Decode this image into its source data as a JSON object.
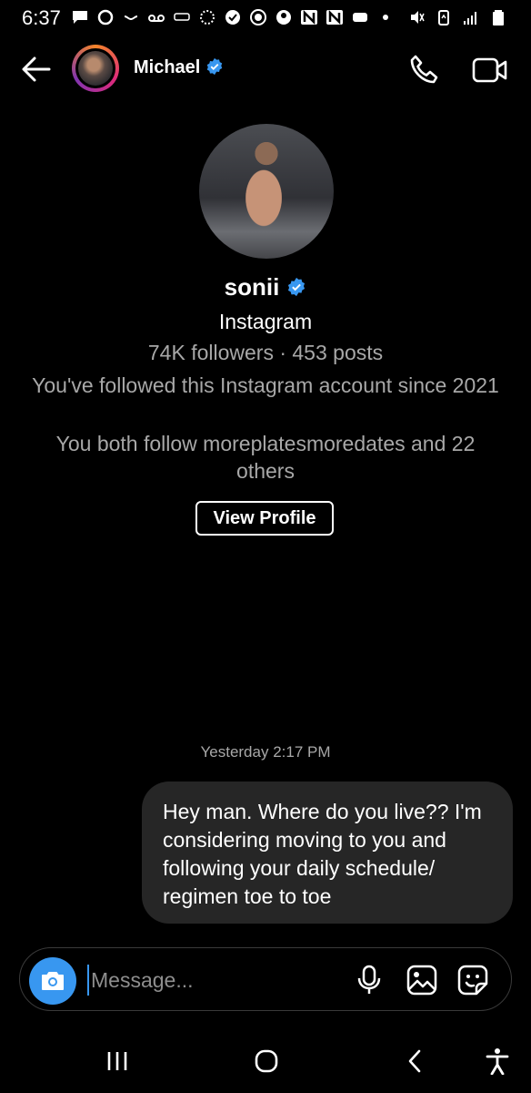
{
  "status_bar": {
    "time": "6:37",
    "left_icons": [
      "chat-bubble-icon",
      "circle-icon",
      "voicemail-icon",
      "voicemail-icon",
      "photos-icon",
      "spinner-icon",
      "check-badge-icon",
      "dollar-icon",
      "person-icon",
      "n-icon",
      "n-icon",
      "message-icon",
      "dot-icon"
    ],
    "right_icons": [
      "mute-icon",
      "battery-saver-icon",
      "signal-icon",
      "battery-icon"
    ]
  },
  "header": {
    "name": "Michael",
    "verified": true
  },
  "profile": {
    "username": "sonii",
    "verified": true,
    "platform": "Instagram",
    "stats": "74K followers · 453 posts",
    "followed_since": "You've followed this Instagram account since 2021",
    "mutual": "You both follow moreplatesmoredates and 22 others",
    "view_profile_label": "View Profile"
  },
  "conversation": {
    "timestamp": "Yesterday 2:17 PM",
    "messages": [
      {
        "sender": "me",
        "text": "Hey man. Where do you live?? I'm considering moving to you and following your daily schedule/ regimen toe to toe"
      }
    ]
  },
  "composer": {
    "placeholder": "Message...",
    "value": ""
  },
  "colors": {
    "background": "#000000",
    "bubble": "#262626",
    "accent": "#3897f0",
    "secondary_text": "#a8a8a8"
  }
}
